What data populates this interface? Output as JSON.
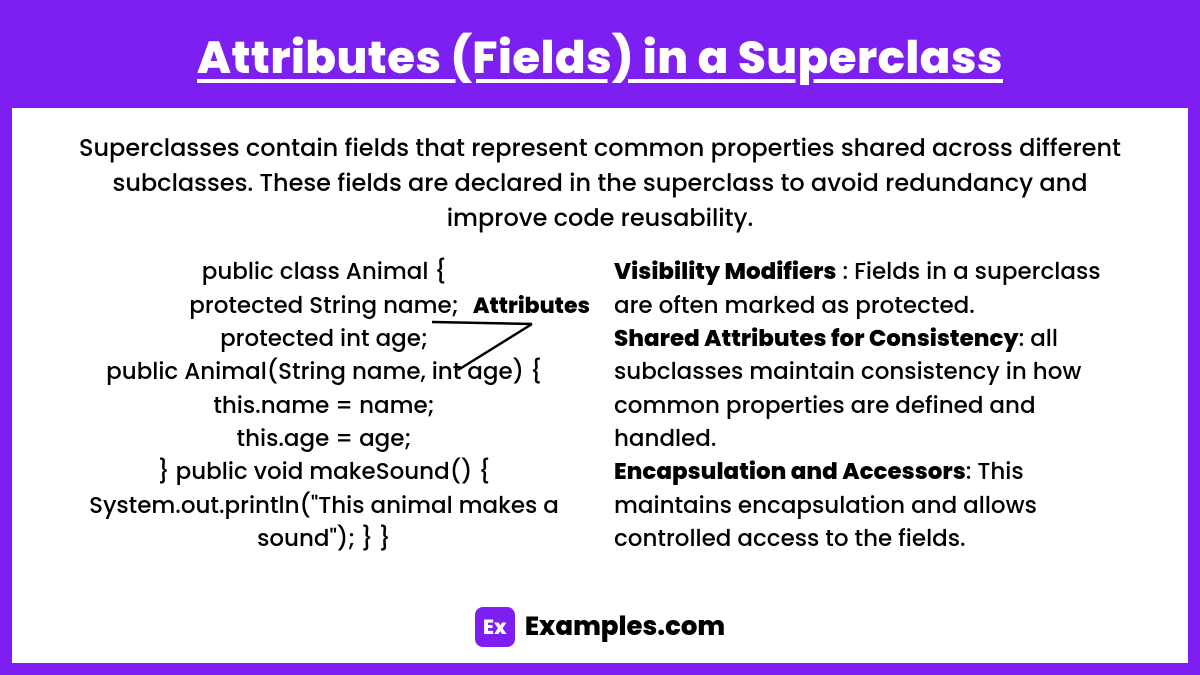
{
  "title": "Attributes (Fields) in a Superclass",
  "intro": "Superclasses contain fields that represent common properties shared across different subclasses. These fields are declared in the superclass to avoid redundancy and improve code reusability.",
  "code": {
    "l1": "public class Animal {",
    "l2": "protected String name;",
    "l3": "protected int age;",
    "l4": "public Animal(String name, int age) {",
    "l5": "this.name = name;",
    "l6": "this.age = age;",
    "l7": "} public void makeSound() {",
    "l8": "System.out.println(\"This animal makes a",
    "l9": "sound\"); } }"
  },
  "annotation": "Attributes",
  "points": {
    "p1_label": "Visibility Modifiers",
    "p1_text": " : Fields in a superclass are often marked as protected.",
    "p2_label": "Shared Attributes for Consistency",
    "p2_text": ": all subclasses maintain consistency in how common properties are defined and handled.",
    "p3_label": "Encapsulation and Accessors",
    "p3_text": ": This maintains encapsulation and allows controlled access to the fields."
  },
  "logo_text": "Ex",
  "brand": "Examples.com"
}
